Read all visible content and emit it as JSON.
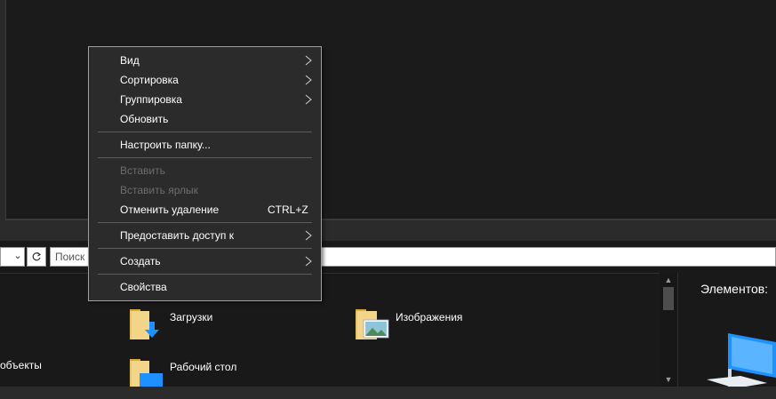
{
  "context_menu": {
    "items": [
      {
        "label": "Вид",
        "submenu": true,
        "disabled": false
      },
      {
        "label": "Сортировка",
        "submenu": true,
        "disabled": false
      },
      {
        "label": "Группировка",
        "submenu": true,
        "disabled": false
      },
      {
        "label": "Обновить",
        "submenu": false,
        "disabled": false
      },
      {
        "label": "Настроить папку...",
        "submenu": false,
        "disabled": false
      },
      {
        "label": "Вставить",
        "submenu": false,
        "disabled": true
      },
      {
        "label": "Вставить ярлык",
        "submenu": false,
        "disabled": true
      },
      {
        "label": "Отменить удаление",
        "shortcut": "CTRL+Z",
        "submenu": false,
        "disabled": false
      },
      {
        "label": "Предоставить доступ к",
        "submenu": true,
        "disabled": false
      },
      {
        "label": "Создать",
        "submenu": true,
        "disabled": false
      },
      {
        "label": "Свойства",
        "submenu": false,
        "disabled": false
      }
    ]
  },
  "address_bar": {
    "search_placeholder": "Поиск",
    "chevron_icon": "chevron-down-icon",
    "refresh_icon": "refresh-icon"
  },
  "files": {
    "items": [
      {
        "label": "Загрузки",
        "icon": "downloads-folder-icon"
      },
      {
        "label": "Изображения",
        "icon": "pictures-folder-icon"
      },
      {
        "label": "Рабочий стол",
        "icon": "desktop-folder-icon"
      }
    ],
    "partial_label": "объекты"
  },
  "details": {
    "title": "Элементов: "
  },
  "colors": {
    "menu_bg": "#2b2b2b",
    "menu_border": "#a0a0a0",
    "folder_yellow": "#e8c46a",
    "accent_blue": "#1e90ff"
  }
}
